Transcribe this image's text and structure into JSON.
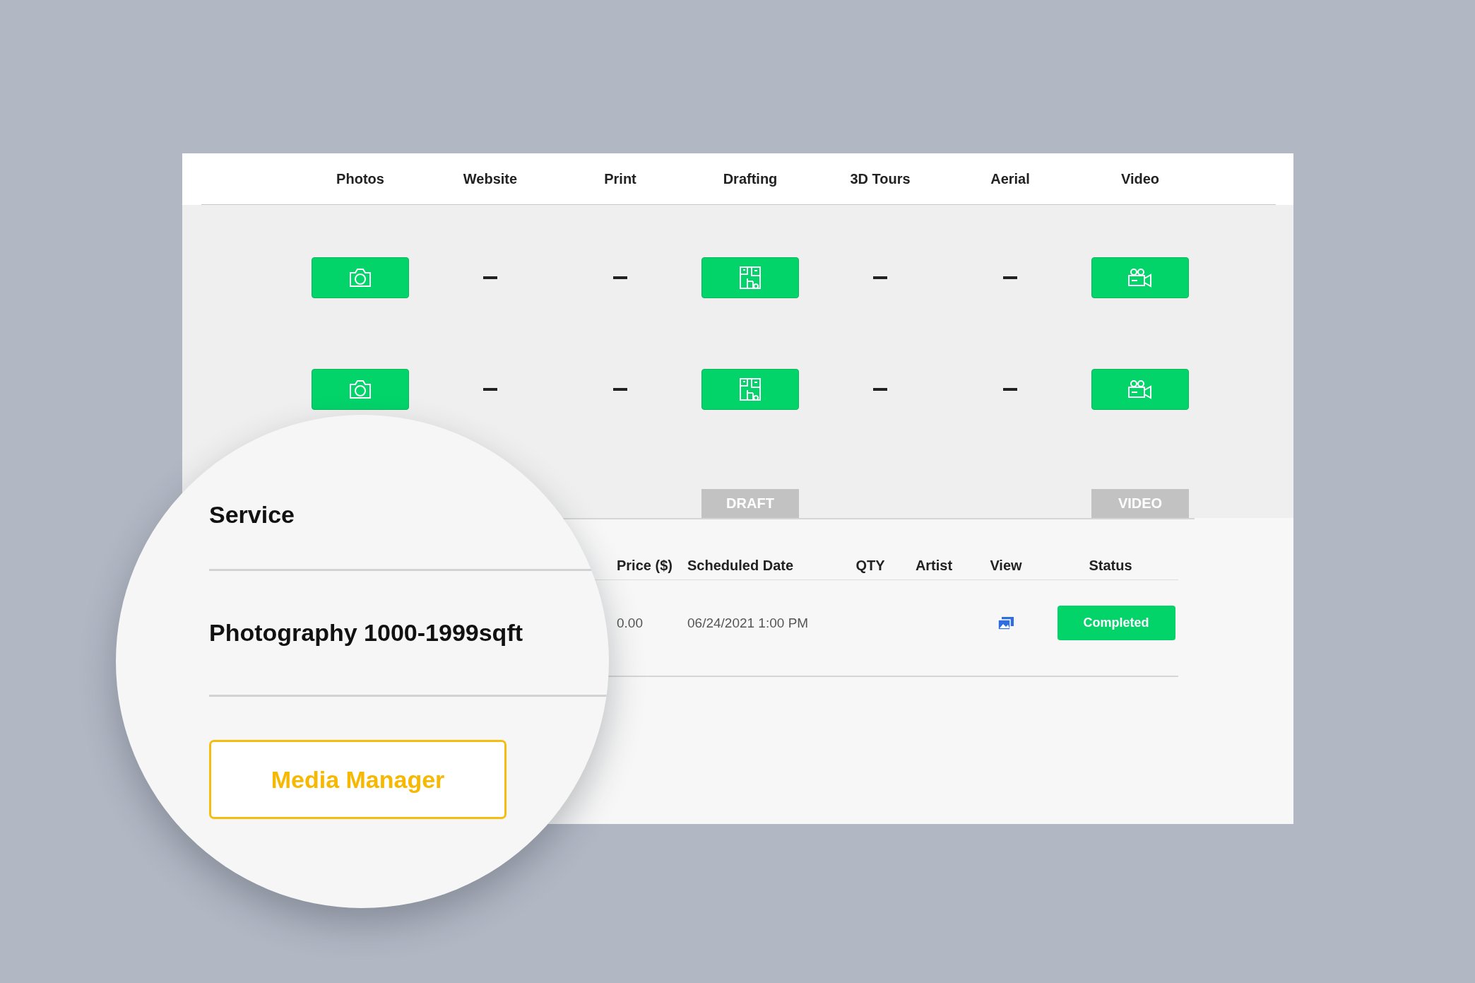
{
  "service_columns": [
    "Photos",
    "Website",
    "Print",
    "Drafting",
    "3D Tours",
    "Aerial",
    "Video"
  ],
  "service_rows": [
    {
      "cells": [
        {
          "kind": "camera"
        },
        {
          "kind": "dash"
        },
        {
          "kind": "dash"
        },
        {
          "kind": "floorplan"
        },
        {
          "kind": "dash"
        },
        {
          "kind": "dash"
        },
        {
          "kind": "video"
        }
      ]
    },
    {
      "cells": [
        {
          "kind": "camera"
        },
        {
          "kind": "dash"
        },
        {
          "kind": "dash"
        },
        {
          "kind": "floorplan"
        },
        {
          "kind": "dash"
        },
        {
          "kind": "dash"
        },
        {
          "kind": "video"
        }
      ]
    }
  ],
  "tag_row": [
    {
      "kind": "empty"
    },
    {
      "kind": "empty"
    },
    {
      "kind": "empty"
    },
    {
      "kind": "tag",
      "label": "DRAFT"
    },
    {
      "kind": "empty"
    },
    {
      "kind": "empty"
    },
    {
      "kind": "tag",
      "label": "VIDEO"
    }
  ],
  "order_table": {
    "columns": [
      "Price ($)",
      "Scheduled Date",
      "QTY",
      "Artist",
      "View",
      "Status"
    ],
    "rows": [
      {
        "price": "0.00",
        "scheduled_date": "06/24/2021 1:00 PM",
        "status": "Completed"
      }
    ]
  },
  "magnifier": {
    "column": "Service",
    "value": "Photography 1000-1999sqft",
    "button": "Media Manager"
  }
}
